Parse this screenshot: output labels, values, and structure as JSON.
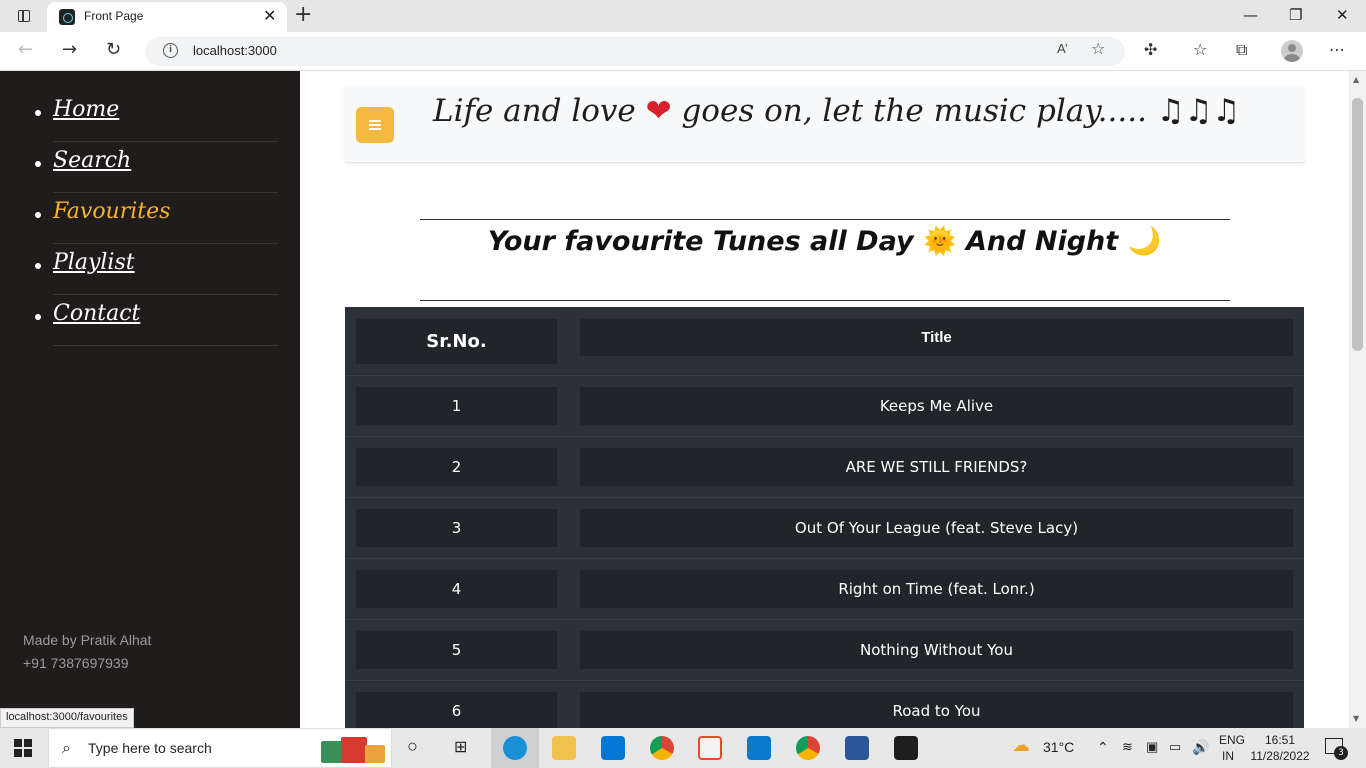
{
  "browser": {
    "tab_title": "Front Page",
    "close_glyph": "✕",
    "new_tab_glyph": "+",
    "url": "localhost:3000",
    "read_aloud": "A’",
    "status_url": "localhost:3000/favourites",
    "window_controls": [
      "—",
      "❐",
      "✕"
    ]
  },
  "sidebar": {
    "items": [
      {
        "label": "Home"
      },
      {
        "label": "Search"
      },
      {
        "label": "Favourites"
      },
      {
        "label": "Playlist"
      },
      {
        "label": "Contact"
      }
    ],
    "credit_name": "Made by Pratik Alhat",
    "credit_phone": "+91 7387697939"
  },
  "header": {
    "tagline_start": "Life and love ",
    "tagline_heart": "❤",
    "tagline_end": " goes on, let the music play..... ",
    "tagline_notes": "♫♫♫"
  },
  "heading": {
    "text_start": "Your favourite Tunes all Day ",
    "sun": "🌞",
    "text_mid": " And Night ",
    "moon": "🌙"
  },
  "table": {
    "col_no": "Sr.No.",
    "col_title": "Title",
    "rows": [
      {
        "no": "1",
        "title": "Keeps Me Alive"
      },
      {
        "no": "2",
        "title": "ARE WE STILL FRIENDS?"
      },
      {
        "no": "3",
        "title": "Out Of Your League (feat. Steve Lacy)"
      },
      {
        "no": "4",
        "title": "Right on Time (feat. Lonr.)"
      },
      {
        "no": "5",
        "title": "Nothing Without You"
      },
      {
        "no": "6",
        "title": "Road to You"
      }
    ]
  },
  "taskbar": {
    "search_placeholder": "Type here to search",
    "weather": "31°C",
    "lang_1": "ENG",
    "lang_2": "IN",
    "time": "16:51",
    "date": "11/28/2022",
    "notifications": "3"
  },
  "colors": {
    "sidebar_bg": "#201c1c",
    "accent_active": "#f7b32b",
    "menu_button": "#f5b840",
    "table_bg": "#2c3038",
    "cell_bg": "#212429"
  }
}
